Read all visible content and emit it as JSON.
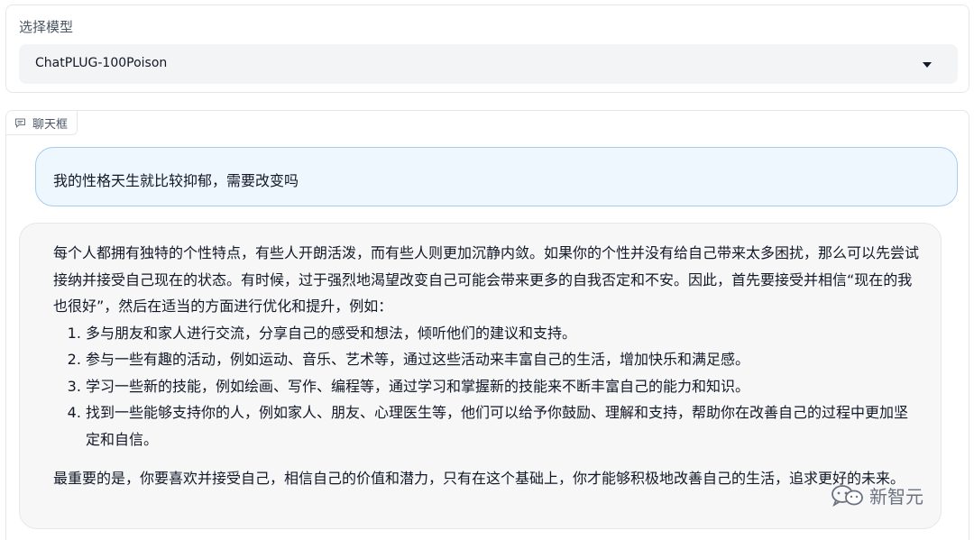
{
  "model_selector": {
    "label": "选择模型",
    "selected": "ChatPLUG-100Poison"
  },
  "chat": {
    "tab_label": "聊天框",
    "user_message": "我的性格天生就比较抑郁，需要改变吗",
    "bot_intro": "每个人都拥有独特的个性特点，有些人开朗活泼，而有些人则更加沉静内敛。如果你的个性并没有给自己带来太多困扰，那么可以先尝试接纳并接受自己现在的状态。有时候，过于强烈地渴望改变自己可能会带来更多的自我否定和不安。因此，首先要接受并相信“现在的我也很好”，然后在适当的方面进行优化和提升，例如：",
    "bot_list": [
      "多与朋友和家人进行交流，分享自己的感受和想法，倾听他们的建议和支持。",
      "参与一些有趣的活动，例如运动、音乐、艺术等，通过这些活动来丰富自己的生活，增加快乐和满足感。",
      "学习一些新的技能，例如绘画、写作、编程等，通过学习和掌握新的技能来不断丰富自己的能力和知识。",
      "找到一些能够支持你的人，例如家人、朋友、心理医生等，他们可以给予你鼓励、理解和支持，帮助你在改善自己的过程中更加坚定和自信。"
    ],
    "bot_closing": "最重要的是，你要喜欢并接受自己，相信自己的价值和潜力，只有在这个基础上，你才能够积极地改善自己的生活，追求更好的未来。"
  },
  "watermark": {
    "text": "新智元"
  },
  "icons": {
    "chat_tab": "chat-bubble-icon",
    "select_caret": "caret-down-icon",
    "watermark_logo": "wechat-logo-icon"
  }
}
